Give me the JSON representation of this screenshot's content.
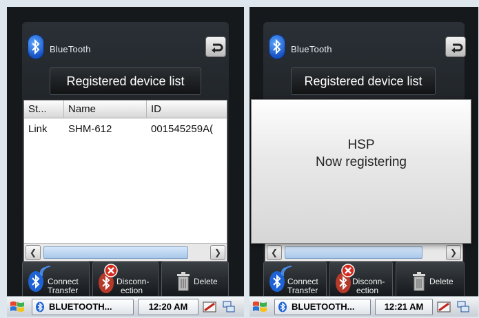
{
  "left": {
    "app_title": "BlueTooth",
    "registered_btn": "Registered device list",
    "columns": [
      "St...",
      "Name",
      "ID"
    ],
    "rows": [
      {
        "status": "Link",
        "name": "SHM-612",
        "id": "001545259A("
      }
    ],
    "toolbar": {
      "connect_line1": "Connect",
      "connect_line2": "Transfer",
      "disconn_line1": "Disconn-",
      "disconn_line2": "ection",
      "delete": "Delete"
    },
    "taskbar": {
      "app": "BLUETOOTH...",
      "time": "12:20 AM"
    }
  },
  "right": {
    "app_title": "BlueTooth",
    "registered_btn": "Registered device list",
    "dialog_line1": "HSP",
    "dialog_line2": "Now registering",
    "toolbar": {
      "connect_line1": "Connect",
      "connect_line2": "Transfer",
      "disconn_line1": "Disconn-",
      "disconn_line2": "ection",
      "delete": "Delete"
    },
    "taskbar": {
      "app": "BLUETOOTH...",
      "time": "12:21 AM"
    }
  },
  "icons": {
    "bluetooth": "bluetooth-icon",
    "back": "back-arrow-icon",
    "delete": "trash-icon",
    "start": "windows-flag-icon",
    "sync": "sync-icon",
    "network": "network-icon"
  }
}
